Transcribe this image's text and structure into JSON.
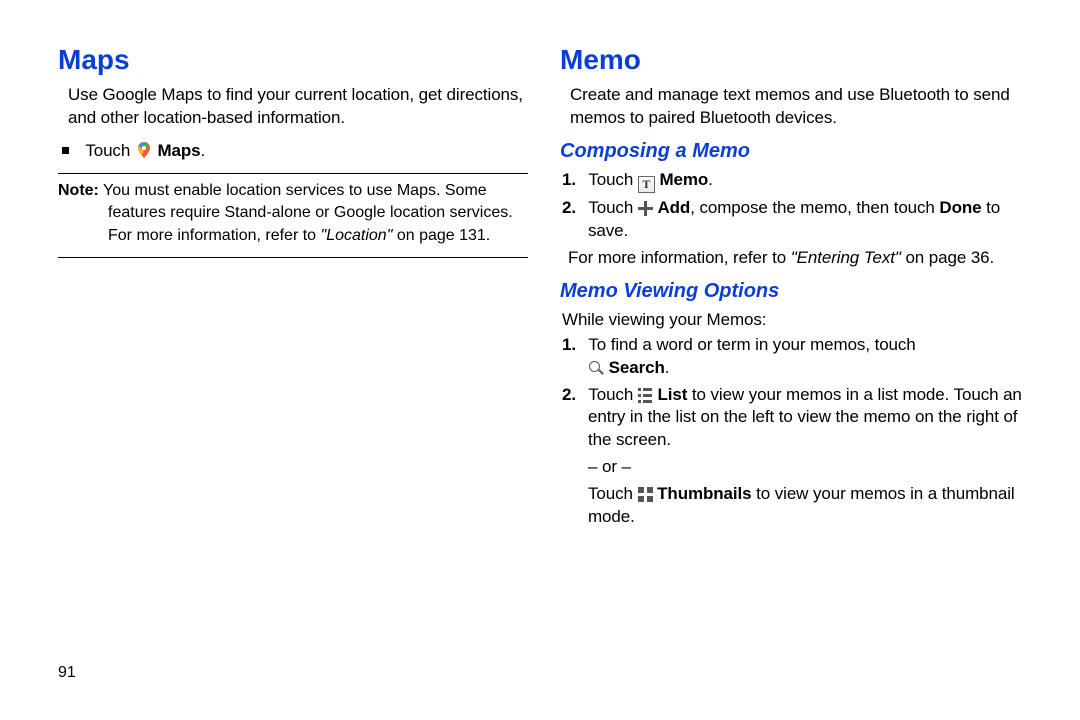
{
  "page_number": "91",
  "left": {
    "heading": "Maps",
    "intro": "Use Google Maps to find your current location, get directions, and other location-based information.",
    "touch_prefix": "Touch ",
    "touch_app": "Maps",
    "note_label": "Note:",
    "note_text_1": " You must enable location services to use Maps. Some features require Stand-alone or Google location services. For more information, refer to ",
    "note_ref": "\"Location\"",
    "note_text_2": " on page 131."
  },
  "right": {
    "heading": "Memo",
    "intro": "Create and manage text memos and use Bluetooth to send memos to paired Bluetooth devices.",
    "compose_heading": "Composing a Memo",
    "compose_step1_prefix": "Touch ",
    "compose_step1_app": "Memo",
    "compose_step2_prefix": "Touch ",
    "compose_step2_add": "Add",
    "compose_step2_mid": ", compose the memo, then touch ",
    "compose_step2_done": "Done",
    "compose_step2_end": " to save.",
    "compose_more_prefix": "For more information, refer to ",
    "compose_more_ref": "\"Entering Text\"",
    "compose_more_suffix": " on page 36.",
    "view_heading": "Memo Viewing Options",
    "view_intro": "While viewing your Memos:",
    "view_step1_line1": "To find a word or term in your memos, touch",
    "view_step1_search": "Search",
    "view_step2_prefix": "Touch ",
    "view_step2_list": "List",
    "view_step2_rest": " to view your memos in a list mode. Touch an entry in the list on the left to view the memo on the right of the screen.",
    "view_or": "– or –",
    "view_thumb_prefix": "Touch ",
    "view_thumb_label": "Thumbnails",
    "view_thumb_rest": " to view your memos in a thumbnail mode."
  }
}
